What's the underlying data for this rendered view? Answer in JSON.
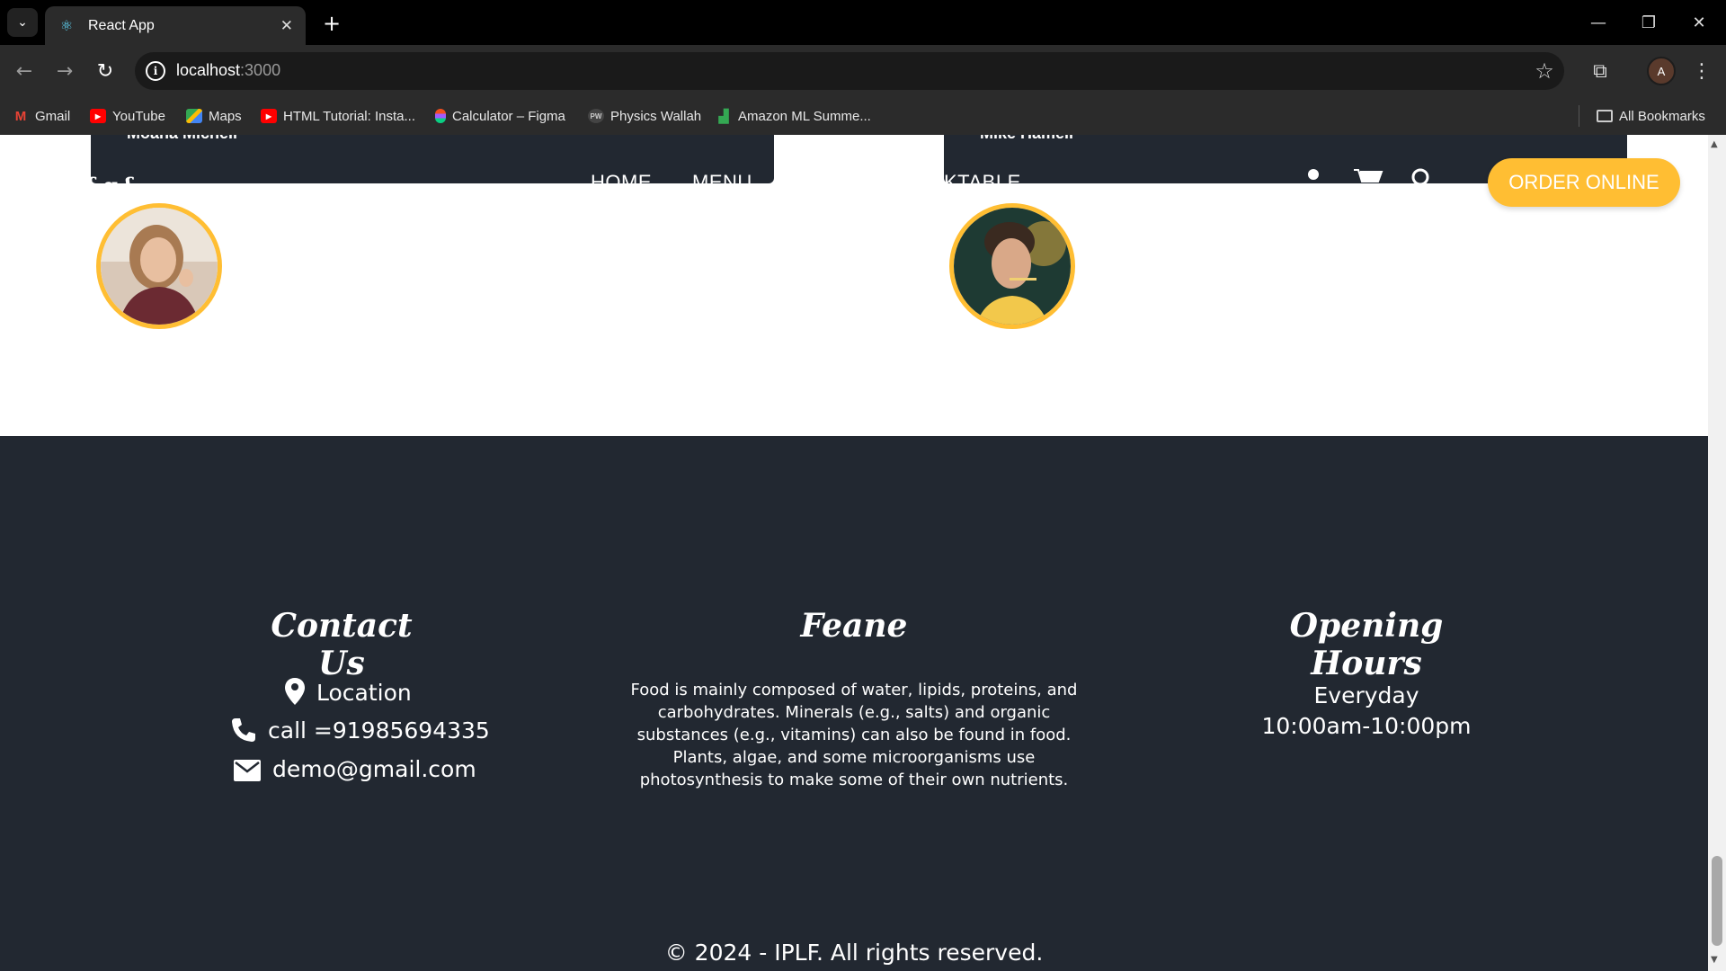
{
  "browser": {
    "tab_title": "React App",
    "url_host": "localhost",
    "url_port": ":3000",
    "profile_initial": "A",
    "bookmarks": [
      {
        "label": "Gmail",
        "icon": "gmail-icon"
      },
      {
        "label": "YouTube",
        "icon": "youtube-icon"
      },
      {
        "label": "Maps",
        "icon": "maps-icon"
      },
      {
        "label": "HTML Tutorial: Insta...",
        "icon": "youtube-icon"
      },
      {
        "label": "Calculator – Figma",
        "icon": "figma-icon"
      },
      {
        "label": "Physics Wallah",
        "icon": "pw-icon"
      },
      {
        "label": "Amazon ML Summe...",
        "icon": "amazon-ml-icon"
      }
    ],
    "all_bookmarks_label": "All Bookmarks"
  },
  "header": {
    "nav_home": "HOME",
    "nav_menu": "MENU",
    "nav_booktable_cut": "KTABLE",
    "order_button": "ORDER ONLINE"
  },
  "clients": [
    {
      "name_cut": "Moana Michell"
    },
    {
      "name_cut": "Mike Hamell"
    }
  ],
  "footer": {
    "contact": {
      "heading": "Contact Us",
      "location": "Location",
      "phone": "call =91985694335",
      "email": "demo@gmail.com"
    },
    "about": {
      "heading": "Feane",
      "text": "Food is mainly composed of water, lipids, proteins, and carbohydrates. Minerals (e.g., salts) and organic substances (e.g., vitamins) can also be found in food. Plants, algae, and some microorganisms use photosynthesis to make some of their own nutrients."
    },
    "hours": {
      "heading": "Opening Hours",
      "days": "Everyday",
      "time": "10:00am-10:00pm"
    },
    "copyright": "© 2024 - IPLF. All rights reserved."
  },
  "colors": {
    "accent": "#ffbe33",
    "dark": "#222831"
  }
}
